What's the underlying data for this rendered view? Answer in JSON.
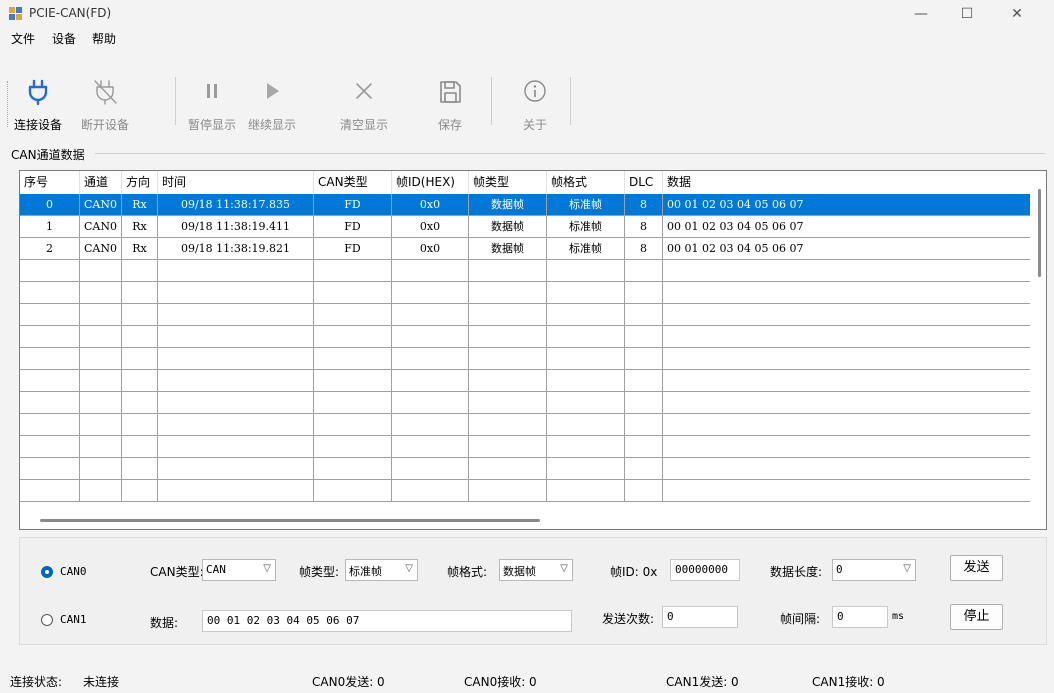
{
  "window": {
    "title": "PCIE-CAN(FD)",
    "minimize": "—",
    "maximize": "☐",
    "close": "✕"
  },
  "menu": [
    "文件",
    "设备",
    "帮助"
  ],
  "toolbar": {
    "buttons": [
      {
        "label": "连接设备",
        "icon": "plug-icon",
        "enabled": true
      },
      {
        "label": "断开设备",
        "icon": "unplug-icon",
        "enabled": false
      },
      {
        "label": "暂停显示",
        "icon": "pause-icon",
        "enabled": false
      },
      {
        "label": "继续显示",
        "icon": "play-icon",
        "enabled": false
      },
      {
        "label": "清空显示",
        "icon": "clear-icon",
        "enabled": false
      },
      {
        "label": "保存",
        "icon": "save-icon",
        "enabled": false
      },
      {
        "label": "关于",
        "icon": "info-icon",
        "enabled": false
      }
    ]
  },
  "channel_group": {
    "label": "CAN通道数据"
  },
  "grid": {
    "columns": [
      "序号",
      "通道",
      "方向",
      "时间",
      "CAN类型",
      "帧ID(HEX)",
      "帧类型",
      "帧格式",
      "DLC",
      "数据"
    ],
    "rows": [
      {
        "index": "0",
        "channel": "CAN0",
        "dir": "Rx",
        "time": "09/18 11:38:17.835",
        "can_type": "FD",
        "id": "0x0",
        "frame_type": "数据帧",
        "frame_format": "标准帧",
        "dlc": "8",
        "data": "00 01 02 03 04 05 06 07",
        "selected": true
      },
      {
        "index": "1",
        "channel": "CAN0",
        "dir": "Rx",
        "time": "09/18 11:38:19.411",
        "can_type": "FD",
        "id": "0x0",
        "frame_type": "数据帧",
        "frame_format": "标准帧",
        "dlc": "8",
        "data": "00 01 02 03 04 05 06 07",
        "selected": false
      },
      {
        "index": "2",
        "channel": "CAN0",
        "dir": "Rx",
        "time": "09/18 11:38:19.821",
        "can_type": "FD",
        "id": "0x0",
        "frame_type": "数据帧",
        "frame_format": "标准帧",
        "dlc": "8",
        "data": "00 01 02 03 04 05 06 07",
        "selected": false
      }
    ]
  },
  "send": {
    "can0_label": "CAN0",
    "can1_label": "CAN1",
    "selected_channel": "CAN0",
    "can_type_label": "CAN类型:",
    "can_type_value": "CAN",
    "frame_type_label": "帧类型:",
    "frame_type_value": "标准帧",
    "frame_format_label": "帧格式:",
    "frame_format_value": "数据帧",
    "frame_id_label": "帧ID: 0x",
    "frame_id_value": "00000000",
    "data_length_label": "数据长度:",
    "data_length_value": "0",
    "data_label": "数据:",
    "data_value": "00 01 02 03 04 05 06 07",
    "send_count_label": "发送次数:",
    "send_count_value": "0",
    "interval_label": "帧间隔:",
    "interval_value": "0",
    "interval_unit": "ms",
    "send_button": "发送",
    "stop_button": "停止"
  },
  "status": {
    "conn_label": "连接状态:",
    "conn_value": "未连接",
    "can0_send": "CAN0发送:  0",
    "can0_recv": "CAN0接收:  0",
    "can1_send": "CAN1发送:  0",
    "can1_recv": "CAN1接收:  0"
  }
}
